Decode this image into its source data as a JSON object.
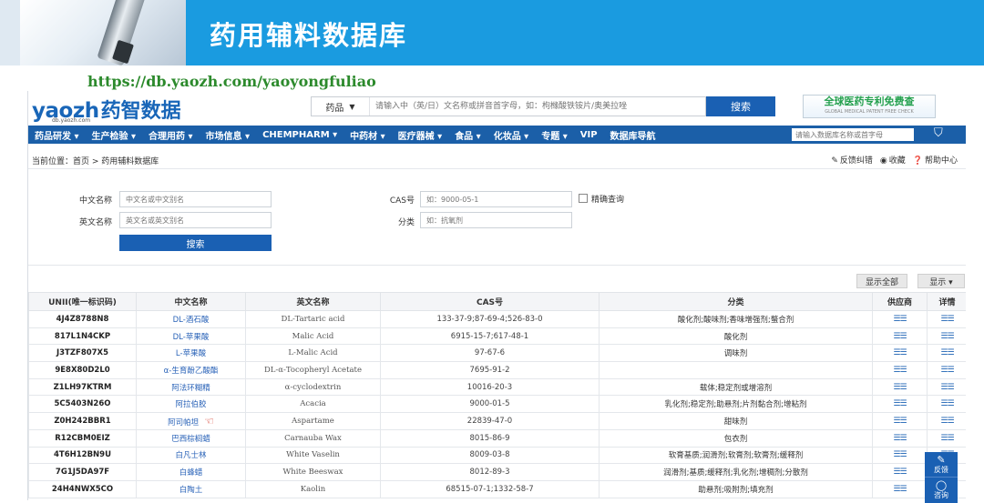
{
  "slide": {
    "title": "药用辅料数据库",
    "url": "https://db.yaozh.com/yaoyongfuliao"
  },
  "site": {
    "logo_latin": "yaozh",
    "logo_cn": "药智数据",
    "logo_sub": "db.yaozh.com",
    "search_select": "药品",
    "search_placeholder": "请输入中（英/日）文名称或拼音首字母，如：枸橼酸铁铵片/奥美拉唑",
    "search_button": "搜索",
    "promo_line1": "全球医药专利免费查",
    "promo_line2": "GLOBAL MEDICAL PATENT FREE CHECK",
    "nav": [
      "药品研发 ▾",
      "生产检验 ▾",
      "合理用药 ▾",
      "市场信息 ▾",
      "CHEMPHARM ▾",
      "中药材 ▾",
      "医疗器械 ▾",
      "食品 ▾",
      "化妆品 ▾",
      "专题 ▾",
      "VIP",
      "数据库导航"
    ],
    "nav_search_placeholder": "请输入数据库名称或首字母",
    "breadcrumb": "当前位置：首页 > 药用辅料数据库",
    "tools": [
      "反馈纠错",
      "收藏",
      "帮助中心"
    ]
  },
  "form": {
    "cn_name_label": "中文名称",
    "cn_name_placeholder": "中文名或中文别名",
    "en_name_label": "英文名称",
    "en_name_placeholder": "英文名或英文别名",
    "cas_label": "CAS号",
    "cas_placeholder": "如：9000-05-1",
    "class_label": "分类",
    "class_placeholder": "如：抗氧剂",
    "exact_match_label": "精确查询",
    "search_button": "搜索"
  },
  "toolbar": {
    "show_all": "显示全部",
    "show": "显示 ▾"
  },
  "table": {
    "headers": [
      "UNII(唯一标识码)",
      "中文名称",
      "英文名称",
      "CAS号",
      "分类",
      "供应商",
      "详情"
    ],
    "rows": [
      [
        "4J4Z8788N8",
        "DL-酒石酸",
        "DL-Tartaric acid",
        "133-37-9;87-69-4;526-83-0",
        "酸化剂;酸味剂;香味增强剂;螯合剂"
      ],
      [
        "817L1N4CKP",
        "DL-苹果酸",
        "Malic Acid",
        "6915-15-7;617-48-1",
        "酸化剂"
      ],
      [
        "J3TZF807X5",
        "L-苹果酸",
        "L-Malic Acid",
        "97-67-6",
        "调味剂"
      ],
      [
        "9E8X80D2L0",
        "α-生育酚乙酸酯",
        "DL-α-Tocopheryl Acetate",
        "7695-91-2",
        ""
      ],
      [
        "Z1LH97KTRM",
        "阿法环糊精",
        "α-cyclodextrin",
        "10016-20-3",
        "载体;稳定剂或增溶剂"
      ],
      [
        "5C5403N26O",
        "阿拉伯胶",
        "Acacia",
        "9000-01-5",
        "乳化剂;稳定剂;助悬剂;片剂黏合剂;增粘剂"
      ],
      [
        "Z0H242BBR1",
        "阿司帕坦",
        "Aspartame",
        "22839-47-0",
        "甜味剂"
      ],
      [
        "R12CBM0EIZ",
        "巴西棕榈蜡",
        "Carnauba Wax",
        "8015-86-9",
        "包衣剂"
      ],
      [
        "4T6H12BN9U",
        "白凡士林",
        "White Vaselin",
        "8009-03-8",
        "软膏基质;润滑剂;软膏剂;软膏剂;缓释剂"
      ],
      [
        "7G1J5DA97F",
        "白蜂蜡",
        "White Beeswax",
        "8012-89-3",
        "润滑剂;基质;缓释剂;乳化剂;增稠剂;分散剂"
      ],
      [
        "24H4NWX5CO",
        "白陶土",
        "Kaolin",
        "68515-07-1;1332-58-7",
        "助悬剂;吸附剂;填充剂"
      ]
    ]
  },
  "float_panel": {
    "feedback": "反馈",
    "consult": "咨询"
  },
  "colors": {
    "slide_header": "#1a9be0",
    "nav_bar": "#1b5fa8",
    "primary_button": "#1a60b3",
    "url_green": "#2c8a2c",
    "link_blue": "#2a63b8"
  }
}
